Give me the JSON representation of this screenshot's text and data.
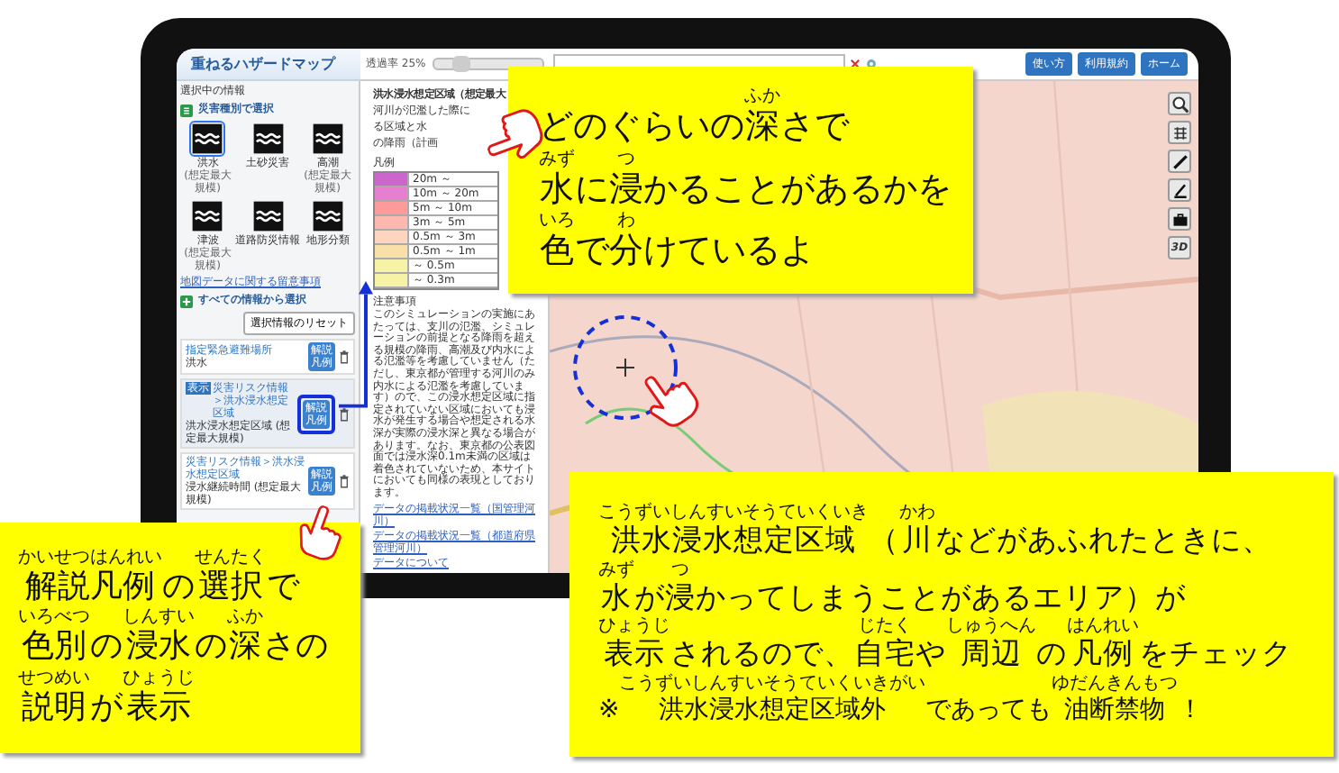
{
  "app": {
    "title": "重ねるハザードマップ",
    "opacity": {
      "label": "透過率 25%",
      "level": 0.25
    },
    "header_buttons": [
      "使い方",
      "利用規約",
      "ホーム"
    ],
    "panel": {
      "heading": "選択中の情報",
      "by_type": "災害種別で選択",
      "hazards": [
        {
          "label": "洪水",
          "note": "(想定最大規模)",
          "selected": true
        },
        {
          "label": "土砂災害",
          "selected": false
        },
        {
          "label": "高潮",
          "note": "(想定最大規模)",
          "selected": false
        },
        {
          "label": "津波",
          "note": "(想定最大規模)",
          "selected": false
        },
        {
          "label": "道路防災情報",
          "selected": false
        },
        {
          "label": "地形分類",
          "selected": false
        }
      ],
      "data_link": "地図データに関する留意事項",
      "all_info": "すべての情報から選択",
      "reset": "選択情報のリセット",
      "layers": [
        {
          "category": "指定緊急避難場所",
          "name": "洪水",
          "legend_button": "解説凡例",
          "highlighted": false
        },
        {
          "badge": "表示",
          "category": "災害リスク情報＞洪水浸水想定区域",
          "name": "洪水浸水想定区域 (想定最大規模)",
          "legend_button": "解説凡例",
          "highlighted": true
        },
        {
          "category": "災害リスク情報＞洪水浸水想定区域",
          "name": "浸水継続時間 (想定最大規模)",
          "legend_button": "解説凡例",
          "highlighted": false
        }
      ]
    },
    "legend_panel": {
      "title": "洪水浸水想定区域（想定最大",
      "description_lines": [
        "河川が氾濫した際に",
        "る区域と水",
        "の降雨（計画"
      ],
      "legend_heading": "凡例",
      "legend": [
        {
          "label": "20m ～",
          "color": "#cc66cc"
        },
        {
          "label": "10m ～ 20m",
          "color": "#e67fd0"
        },
        {
          "label": "5m ～ 10m",
          "color": "#ff9a9a"
        },
        {
          "label": "3m ～ 5m",
          "color": "#ffb8b0"
        },
        {
          "label": "0.5m ～ 3m",
          "color": "#ffd5c0"
        },
        {
          "label": "0.5m ～ 1m",
          "color": "#f8e0a8"
        },
        {
          "label": "～ 0.5m",
          "color": "#f7f3a6"
        },
        {
          "label": "～ 0.3m",
          "color": "#f7f3a6"
        }
      ],
      "notes_heading": "注意事項",
      "notes": "このシミュレーションの実施にあたっては、支川の氾濫、シミュレーションの前提となる降雨を超える規模の降雨、高潮及び内水による氾濫等を考慮していません（ただし、東京都が管理する河川のみ内水による氾濫を考慮しています）ので、この浸水想定区域に指定されていない区域においても浸水が発生する場合や想定される水深が実際の浸水深と異なる場合があります。なお、東京都の公表図面では浸水深0.1m未満の区域は着色されていないため、本サイトにおいても同様の表現としております。",
      "links": [
        "データの掲載状況一覧（国管理河川）",
        "データの掲載状況一覧（都道府県管理河川）",
        "データについて"
      ]
    },
    "map_tools": [
      {
        "kind": "zoom"
      },
      {
        "kind": "grid"
      },
      {
        "kind": "pen"
      },
      {
        "kind": "pencil"
      },
      {
        "kind": "case"
      },
      {
        "kind": "text",
        "label": "3D"
      }
    ]
  },
  "callouts": [
    {
      "kind": "top",
      "lines": [
        {
          "kind": "main",
          "parts": [
            {
              "text": "どのぐらいの"
            },
            {
              "text": "深",
              "ruby": "ふか"
            },
            {
              "text": "さで"
            }
          ]
        },
        {
          "kind": "main",
          "parts": [
            {
              "text": "水",
              "ruby": "みず"
            },
            {
              "text": "に"
            },
            {
              "text": "浸",
              "ruby": "つ"
            },
            {
              "text": "かることがあるかを"
            }
          ]
        },
        {
          "kind": "main",
          "parts": [
            {
              "text": "色",
              "ruby": "いろ"
            },
            {
              "text": "で"
            },
            {
              "text": "分",
              "ruby": "わ"
            },
            {
              "text": "けているよ"
            }
          ]
        }
      ]
    },
    {
      "kind": "left",
      "lines": [
        {
          "kind": "main",
          "parts": [
            {
              "text": "解説凡例",
              "ruby": "かいせつはんれい"
            },
            {
              "text": "の"
            },
            {
              "text": "選択",
              "ruby": "せんたく"
            },
            {
              "text": "で"
            }
          ]
        },
        {
          "kind": "main",
          "parts": [
            {
              "text": "色別",
              "ruby": "いろべつ"
            },
            {
              "text": "の"
            },
            {
              "text": "浸水",
              "ruby": "しんすい"
            },
            {
              "text": "の"
            },
            {
              "text": "深",
              "ruby": "ふか"
            },
            {
              "text": "さの"
            }
          ]
        },
        {
          "kind": "main",
          "parts": [
            {
              "text": "説明",
              "ruby": "せつめい"
            },
            {
              "text": "が"
            },
            {
              "text": "表示",
              "ruby": "ひょうじ"
            }
          ]
        }
      ]
    },
    {
      "kind": "right",
      "lines": [
        {
          "kind": "main",
          "parts": [
            {
              "text": "洪水浸水想定区域",
              "ruby": "こうずいしんすいそうていくいき"
            },
            {
              "text": "（"
            },
            {
              "text": "川",
              "ruby": "かわ"
            },
            {
              "text": "などがあふれたときに、"
            }
          ]
        },
        {
          "kind": "main",
          "parts": [
            {
              "text": "水",
              "ruby": "みず"
            },
            {
              "text": "が"
            },
            {
              "text": "浸",
              "ruby": "つ"
            },
            {
              "text": "かってしまうことがあるエリア）が"
            }
          ]
        },
        {
          "kind": "main",
          "parts": [
            {
              "text": "表示",
              "ruby": "ひょうじ"
            },
            {
              "text": "されるので、"
            },
            {
              "text": "自宅",
              "ruby": "じたく"
            },
            {
              "text": "や"
            },
            {
              "text": "周辺",
              "ruby": "しゅうへん"
            },
            {
              "text": "の"
            },
            {
              "text": "凡例",
              "ruby": "はんれい"
            },
            {
              "text": "をチェック"
            }
          ]
        },
        {
          "kind": "note",
          "parts": [
            {
              "text": "※"
            },
            {
              "text": "洪水浸水想定区域外",
              "ruby": "こうずいしんすいそうていくいきがい"
            },
            {
              "text": "であっても"
            },
            {
              "text": "油断禁物",
              "ruby": "ゆだんきんもつ"
            },
            {
              "text": "！"
            }
          ]
        }
      ]
    }
  ]
}
